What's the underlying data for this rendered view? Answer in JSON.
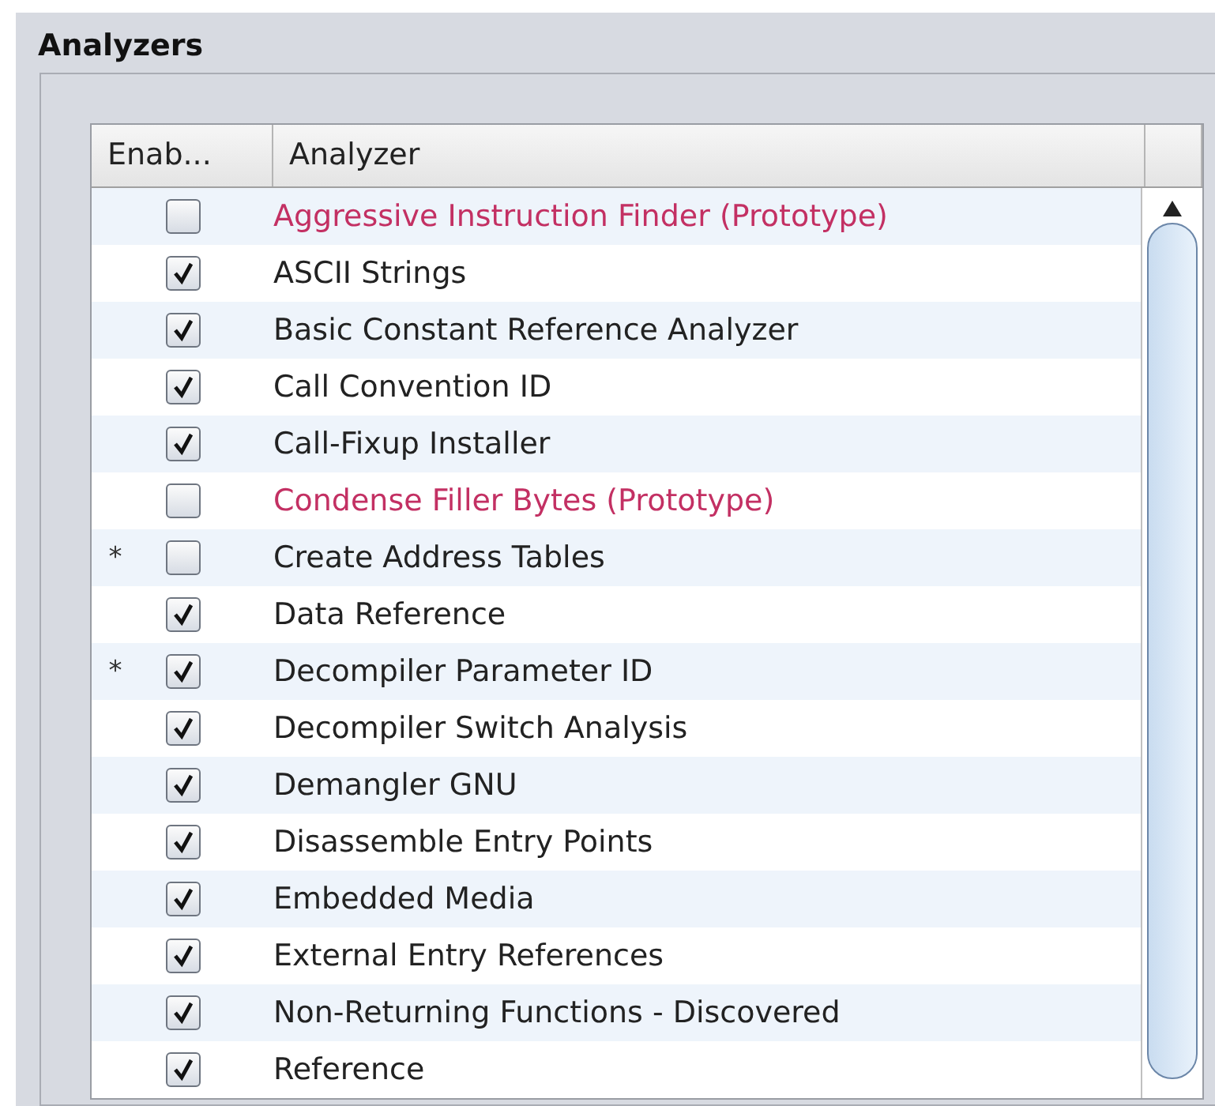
{
  "panel": {
    "title": "Analyzers"
  },
  "table": {
    "columns": [
      "Enab...",
      "Analyzer"
    ],
    "rows": [
      {
        "modified": "",
        "enabled": false,
        "prototype": true,
        "name": "Aggressive Instruction Finder (Prototype)"
      },
      {
        "modified": "",
        "enabled": true,
        "prototype": false,
        "name": "ASCII Strings"
      },
      {
        "modified": "",
        "enabled": true,
        "prototype": false,
        "name": "Basic Constant Reference Analyzer"
      },
      {
        "modified": "",
        "enabled": true,
        "prototype": false,
        "name": "Call Convention ID"
      },
      {
        "modified": "",
        "enabled": true,
        "prototype": false,
        "name": "Call-Fixup Installer"
      },
      {
        "modified": "",
        "enabled": false,
        "prototype": true,
        "name": "Condense Filler Bytes (Prototype)"
      },
      {
        "modified": "*",
        "enabled": false,
        "prototype": false,
        "name": "Create Address Tables"
      },
      {
        "modified": "",
        "enabled": true,
        "prototype": false,
        "name": "Data Reference"
      },
      {
        "modified": "*",
        "enabled": true,
        "prototype": false,
        "name": "Decompiler Parameter ID"
      },
      {
        "modified": "",
        "enabled": true,
        "prototype": false,
        "name": "Decompiler Switch Analysis"
      },
      {
        "modified": "",
        "enabled": true,
        "prototype": false,
        "name": "Demangler GNU"
      },
      {
        "modified": "",
        "enabled": true,
        "prototype": false,
        "name": "Disassemble Entry Points"
      },
      {
        "modified": "",
        "enabled": true,
        "prototype": false,
        "name": "Embedded Media"
      },
      {
        "modified": "",
        "enabled": true,
        "prototype": false,
        "name": "External Entry References"
      },
      {
        "modified": "",
        "enabled": true,
        "prototype": false,
        "name": "Non-Returning Functions - Discovered"
      },
      {
        "modified": "",
        "enabled": true,
        "prototype": false,
        "name": "Reference"
      }
    ]
  }
}
